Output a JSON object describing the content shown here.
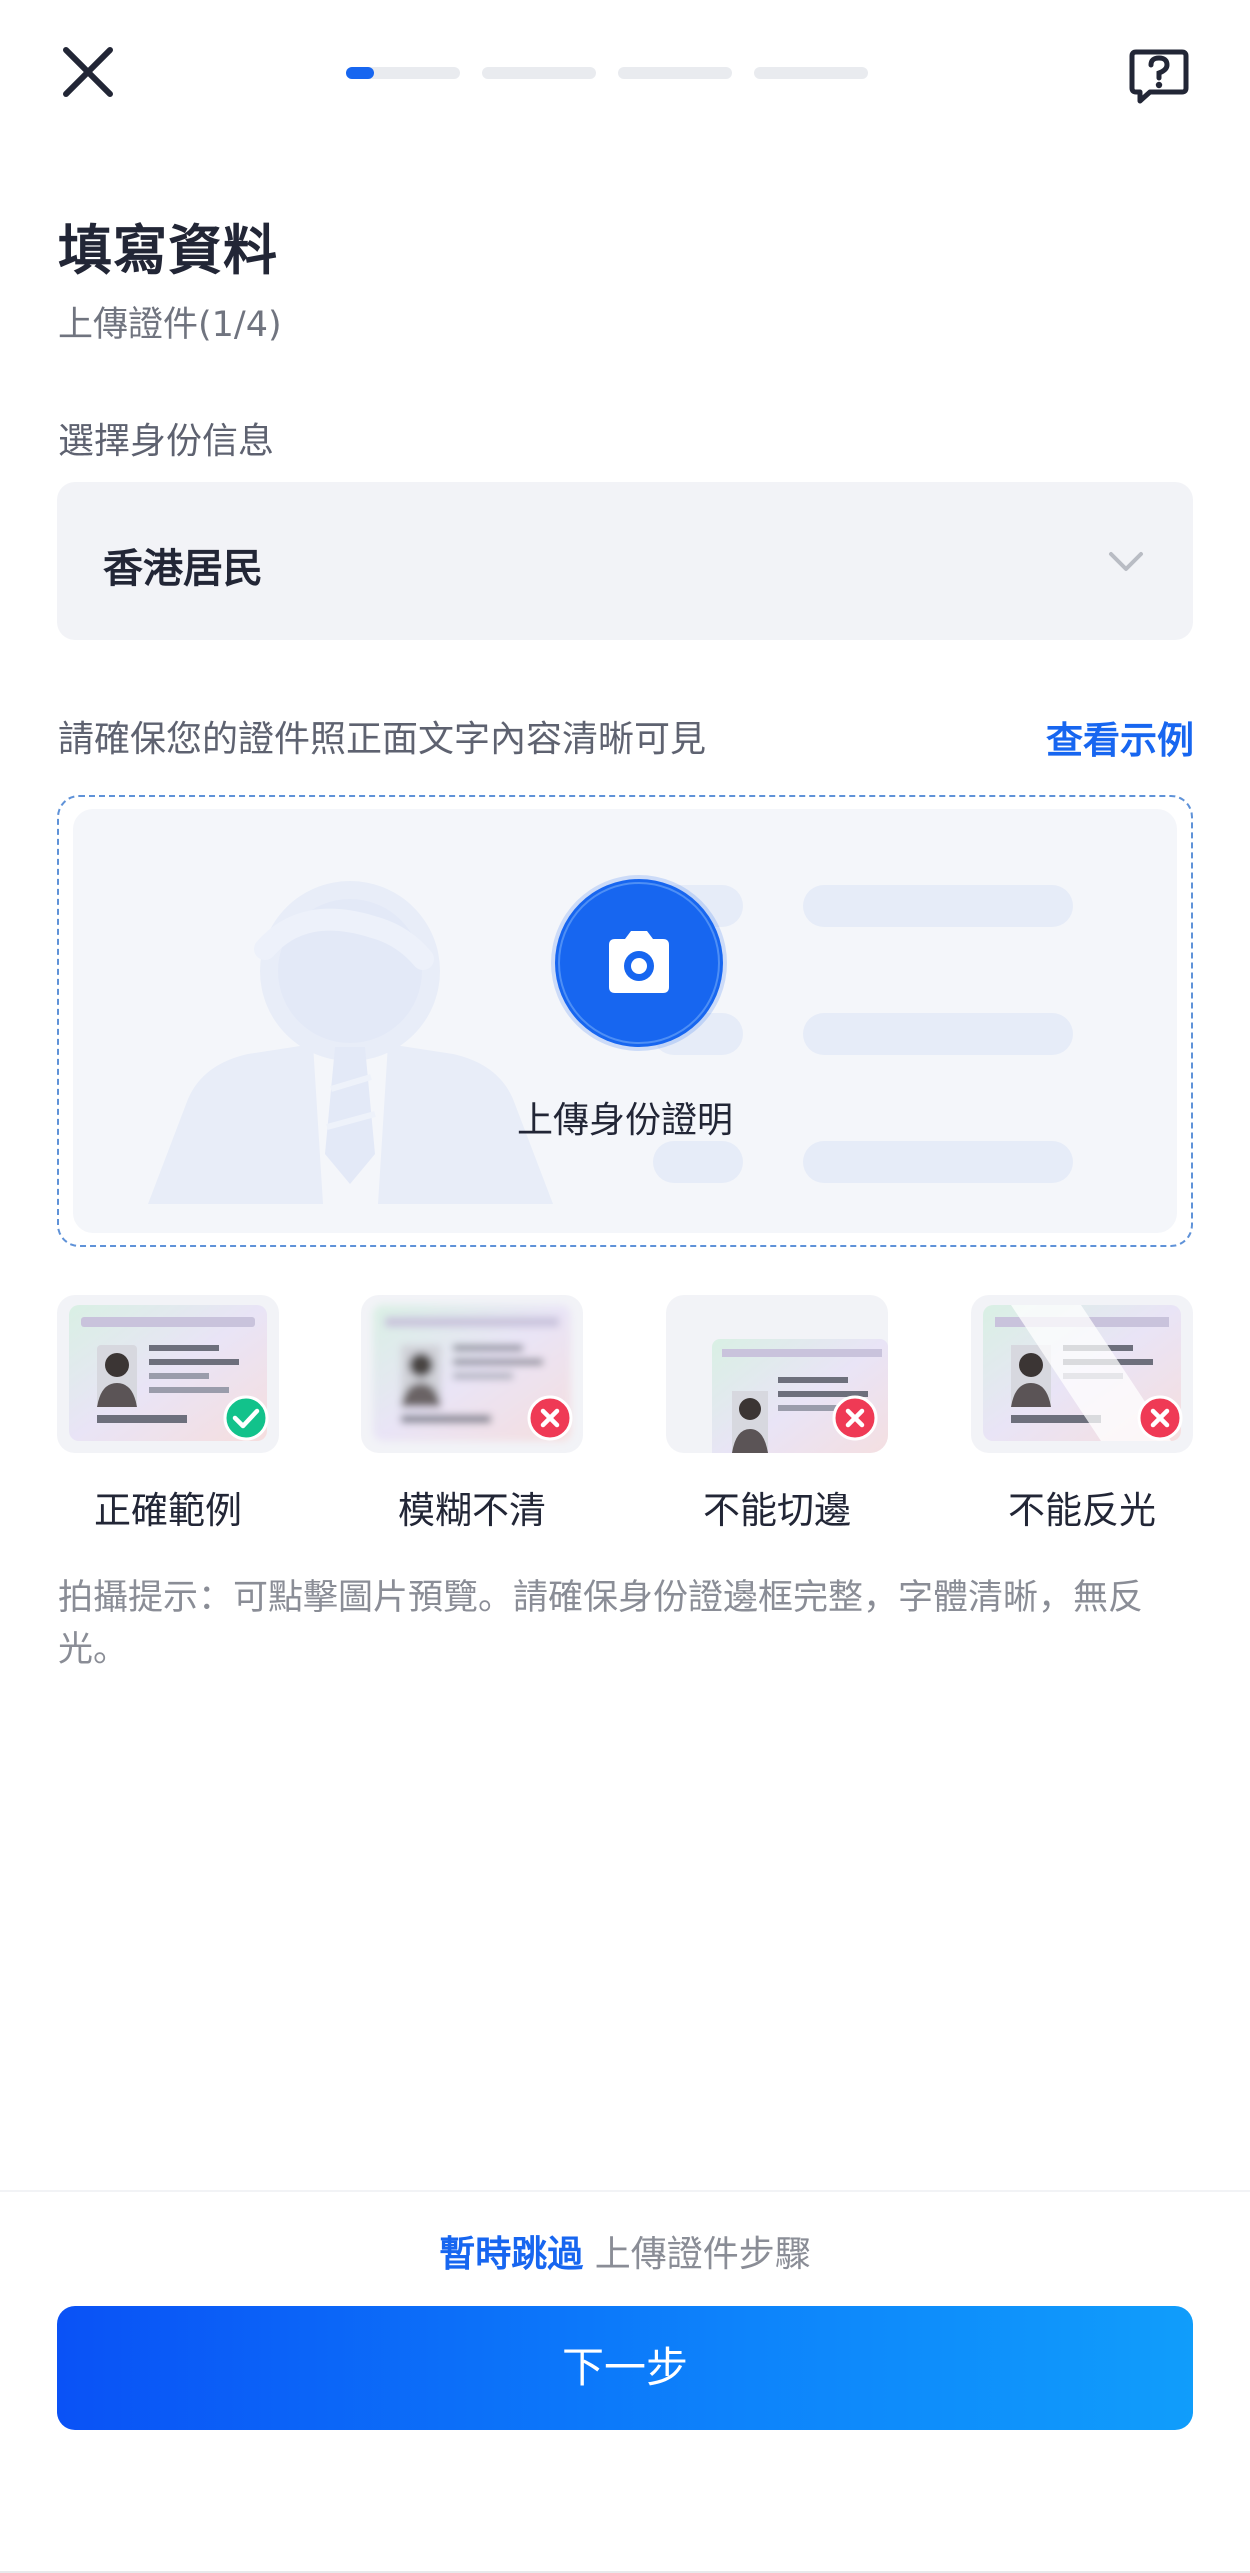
{
  "header": {
    "close_icon": "close-icon",
    "help_icon": "help-question-icon",
    "progress": {
      "current_step": 1,
      "total_steps": 4
    }
  },
  "page": {
    "title": "填寫資料",
    "subtitle": "上傳證件(1/4)"
  },
  "identity": {
    "label": "選擇身份信息",
    "selected": "香港居民",
    "chevron_icon": "chevron-down-icon"
  },
  "upload": {
    "hint": "請確保您的證件照正面文字內容清晰可見",
    "view_example": "查看示例",
    "button_label": "上傳身份證明",
    "camera_icon": "camera-icon"
  },
  "samples": [
    {
      "label": "正確範例",
      "status": "correct",
      "badge_icon": "check-icon",
      "badge_color": "#12c28b"
    },
    {
      "label": "模糊不清",
      "status": "incorrect",
      "badge_icon": "close-icon",
      "badge_color": "#ef3a55"
    },
    {
      "label": "不能切邊",
      "status": "incorrect",
      "badge_icon": "close-icon",
      "badge_color": "#ef3a55"
    },
    {
      "label": "不能反光",
      "status": "incorrect",
      "badge_icon": "close-icon",
      "badge_color": "#ef3a55"
    }
  ],
  "tips": {
    "text": "拍攝提示：可點擊圖片預覽。請確保身份證邊框完整，字體清晰，無反光。"
  },
  "footer": {
    "skip_link": "暫時跳過",
    "skip_suffix": " 上傳證件步驟",
    "next_button": "下一步"
  },
  "colors": {
    "accent": "#1766f0",
    "success": "#12c28b",
    "error": "#ef3a55"
  }
}
